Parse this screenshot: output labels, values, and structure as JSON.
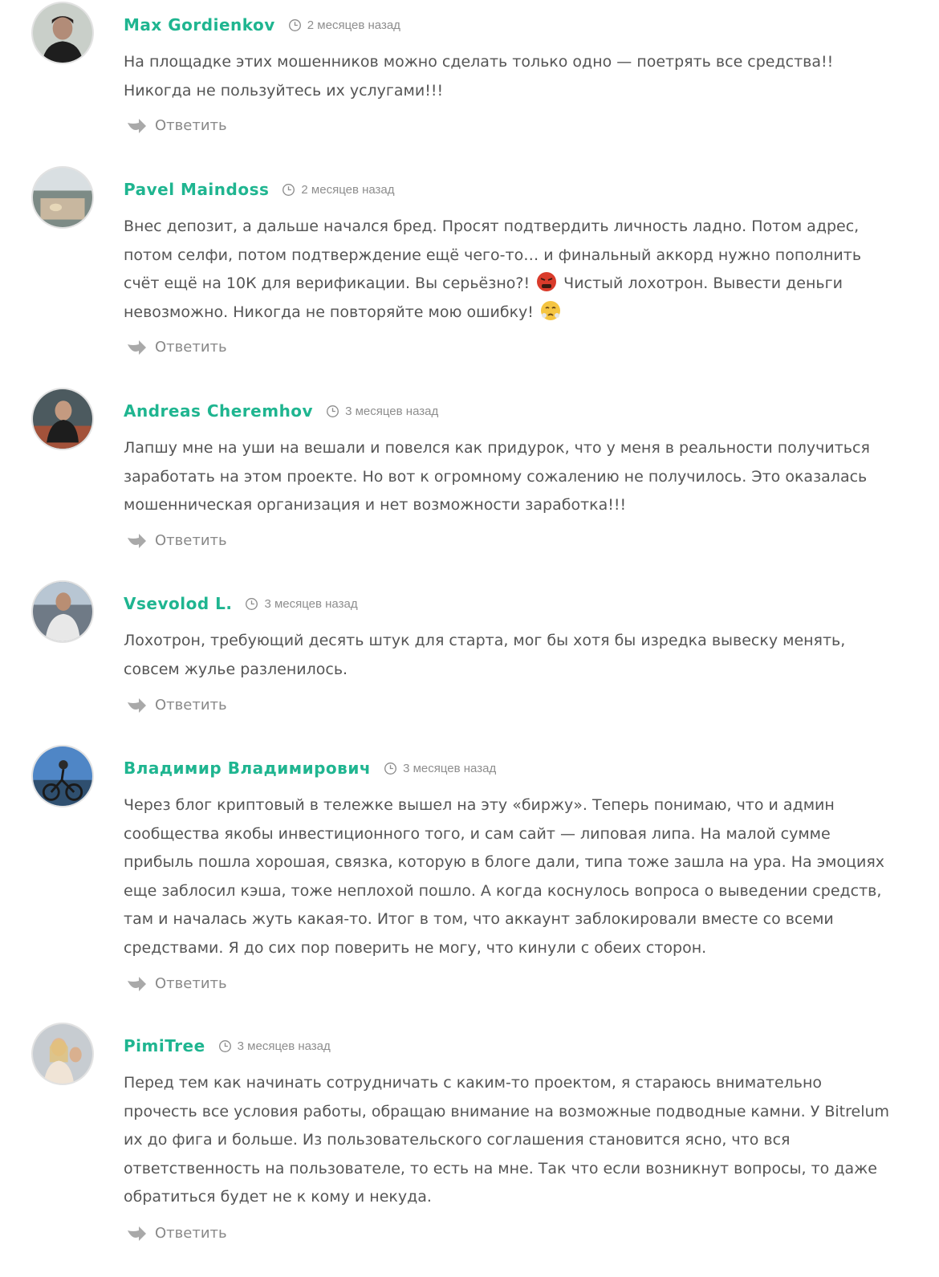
{
  "comments": [
    {
      "author": "Max Gordienkov",
      "time": "2 месяцев назад",
      "text": "На площадке этих мошенников можно сделать только одно — поетрять все средства!! Никогда не пользуйтесь их услугами!!!",
      "reply": "Ответить"
    },
    {
      "author": "Pavel Maindoss",
      "time": "2 месяцев назад",
      "text_parts": [
        "Внес депозит, а дальше начался бред. Просят подтвердить личность ладно. Потом адрес, потом селфи, потом подтверждение ещё чего-то… и финальный аккорд нужно пополнить счёт ещё на 10К для верификации. Вы серьёзно?!",
        "Чистый лохотрон. Вывести деньги невозможно. Никогда не повторяйте мою ошибку!"
      ],
      "emojis": [
        "angry-face-emoji",
        "steam-face-emoji"
      ],
      "reply": "Ответить"
    },
    {
      "author": "Andreas Cheremhov",
      "time": "3 месяцев назад",
      "text": "Лапшу мне на уши на вешали и повелся как придурок, что у меня в реальности получиться заработать на этом проекте. Но вот к огромному сожалению не получилось. Это оказалась мошенническая организация и нет возможности заработка!!!",
      "reply": "Ответить"
    },
    {
      "author": "Vsevolod L.",
      "time": "3 месяцев назад",
      "text": "Лохотрон, требующий десять штук для старта, мог бы хотя бы изредка вывеску менять, совсем жулье разленилось.",
      "reply": "Ответить"
    },
    {
      "author": "Владимир Владимирович",
      "time": "3 месяцев назад",
      "text": "Через блог криптовый в тележке вышел на эту «биржу». Теперь понимаю, что и админ сообщества якобы инвестиционного того, и сам сайт — липовая липа. На малой сумме прибыль пошла хорошая, связка, которую в блоге дали, типа тоже зашла на ура. На эмоциях еще заблосил кэша, тоже неплохой пошло. А когда коснулось вопроса о выведении средств, там и началась жуть какая-то. Итог в том, что аккаунт заблокировали вместе со всеми средствами. Я до сих пор поверить не могу, что кинули с обеих сторон.",
      "reply": "Ответить"
    },
    {
      "author": "PimiTree",
      "time": "3 месяцев назад",
      "text": "Перед тем как начинать сотрудничать с каким-то проектом, я стараюсь внимательно прочесть все условия работы, обращаю внимание на возможные подводные камни. У Bitrelum их до фига и больше. Из пользовательского соглашения становится ясно, что вся ответственность на пользователе, то есть на мне. Так что если возникнут вопросы, то даже обратиться будет не к кому и некуда.",
      "reply": "Ответить"
    }
  ],
  "colors": {
    "author": "#1fb590",
    "text": "#555555",
    "meta": "#8e8e8e",
    "reply": "#888888"
  }
}
